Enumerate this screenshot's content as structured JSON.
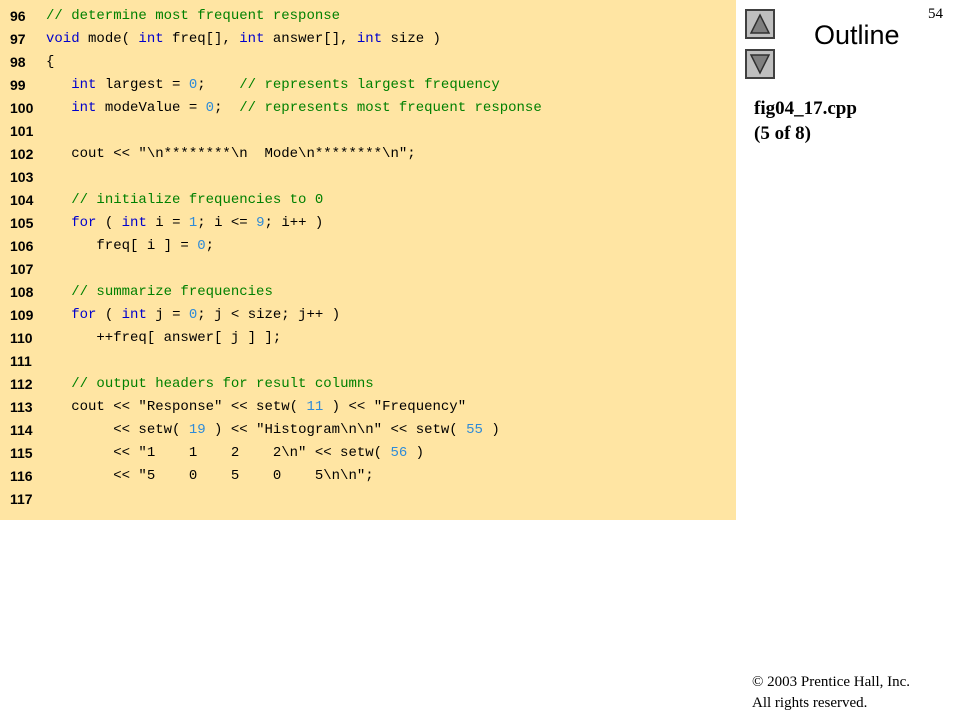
{
  "slide": {
    "page_number": "54",
    "outline_label": "Outline",
    "file_name": "fig04_17.cpp",
    "part": "(5 of 8)",
    "copyright_line1": "© 2003 Prentice Hall, Inc.",
    "copyright_line2": "All rights reserved."
  },
  "nav": {
    "up_icon": "triangle-up-icon",
    "down_icon": "triangle-down-icon"
  },
  "colors": {
    "code_background": "#ffe5a3",
    "comment": "#008000",
    "keyword": "#0000cc",
    "number": "#2e8bd8"
  },
  "code_lines": [
    {
      "num": "96",
      "tokens": [
        [
          "comment",
          "// determine most frequent response"
        ]
      ]
    },
    {
      "num": "97",
      "tokens": [
        [
          "keyword",
          "void"
        ],
        [
          "plain",
          " mode( "
        ],
        [
          "keyword",
          "int"
        ],
        [
          "plain",
          " freq[], "
        ],
        [
          "keyword",
          "int"
        ],
        [
          "plain",
          " answer[], "
        ],
        [
          "keyword",
          "int"
        ],
        [
          "plain",
          " size )"
        ]
      ]
    },
    {
      "num": "98",
      "tokens": [
        [
          "plain",
          "{"
        ]
      ]
    },
    {
      "num": "99",
      "tokens": [
        [
          "plain",
          "   "
        ],
        [
          "keyword",
          "int"
        ],
        [
          "plain",
          " largest = "
        ],
        [
          "number",
          "0"
        ],
        [
          "plain",
          ";    "
        ],
        [
          "comment",
          "// represents largest frequency"
        ]
      ]
    },
    {
      "num": "100",
      "tokens": [
        [
          "plain",
          "   "
        ],
        [
          "keyword",
          "int"
        ],
        [
          "plain",
          " modeValue = "
        ],
        [
          "number",
          "0"
        ],
        [
          "plain",
          ";  "
        ],
        [
          "comment",
          "// represents most frequent response"
        ]
      ]
    },
    {
      "num": "101",
      "tokens": []
    },
    {
      "num": "102",
      "tokens": [
        [
          "plain",
          "   cout << "
        ],
        [
          "string",
          "\"\\n********\\n  Mode\\n********\\n\""
        ],
        [
          "plain",
          ";"
        ]
      ]
    },
    {
      "num": "103",
      "tokens": []
    },
    {
      "num": "104",
      "tokens": [
        [
          "plain",
          "   "
        ],
        [
          "comment",
          "// initialize frequencies to 0"
        ]
      ]
    },
    {
      "num": "105",
      "tokens": [
        [
          "plain",
          "   "
        ],
        [
          "keyword",
          "for"
        ],
        [
          "plain",
          " ( "
        ],
        [
          "keyword",
          "int"
        ],
        [
          "plain",
          " i = "
        ],
        [
          "number",
          "1"
        ],
        [
          "plain",
          "; i <= "
        ],
        [
          "number",
          "9"
        ],
        [
          "plain",
          "; i++ )"
        ]
      ]
    },
    {
      "num": "106",
      "tokens": [
        [
          "plain",
          "      freq[ i ] = "
        ],
        [
          "number",
          "0"
        ],
        [
          "plain",
          ";"
        ]
      ]
    },
    {
      "num": "107",
      "tokens": []
    },
    {
      "num": "108",
      "tokens": [
        [
          "plain",
          "   "
        ],
        [
          "comment",
          "// summarize frequencies"
        ]
      ]
    },
    {
      "num": "109",
      "tokens": [
        [
          "plain",
          "   "
        ],
        [
          "keyword",
          "for"
        ],
        [
          "plain",
          " ( "
        ],
        [
          "keyword",
          "int"
        ],
        [
          "plain",
          " j = "
        ],
        [
          "number",
          "0"
        ],
        [
          "plain",
          "; j < size; j++ )"
        ]
      ]
    },
    {
      "num": "110",
      "tokens": [
        [
          "plain",
          "      ++freq[ answer[ j ] ];"
        ]
      ]
    },
    {
      "num": "111",
      "tokens": []
    },
    {
      "num": "112",
      "tokens": [
        [
          "plain",
          "   "
        ],
        [
          "comment",
          "// output headers for result columns"
        ]
      ]
    },
    {
      "num": "113",
      "tokens": [
        [
          "plain",
          "   cout << "
        ],
        [
          "string",
          "\"Response\""
        ],
        [
          "plain",
          " << setw( "
        ],
        [
          "number",
          "11"
        ],
        [
          "plain",
          " ) << "
        ],
        [
          "string",
          "\"Frequency\""
        ]
      ]
    },
    {
      "num": "114",
      "tokens": [
        [
          "plain",
          "        << setw( "
        ],
        [
          "number",
          "19"
        ],
        [
          "plain",
          " ) << "
        ],
        [
          "string",
          "\"Histogram\\n\\n\""
        ],
        [
          "plain",
          " << setw( "
        ],
        [
          "number",
          "55"
        ],
        [
          "plain",
          " )"
        ]
      ]
    },
    {
      "num": "115",
      "tokens": [
        [
          "plain",
          "        << "
        ],
        [
          "string",
          "\"1    1    2    2\\n\""
        ],
        [
          "plain",
          " << setw( "
        ],
        [
          "number",
          "56"
        ],
        [
          "plain",
          " )"
        ]
      ]
    },
    {
      "num": "116",
      "tokens": [
        [
          "plain",
          "        << "
        ],
        [
          "string",
          "\"5    0    5    0    5\\n\\n\""
        ],
        [
          "plain",
          ";"
        ]
      ]
    },
    {
      "num": "117",
      "tokens": []
    }
  ]
}
